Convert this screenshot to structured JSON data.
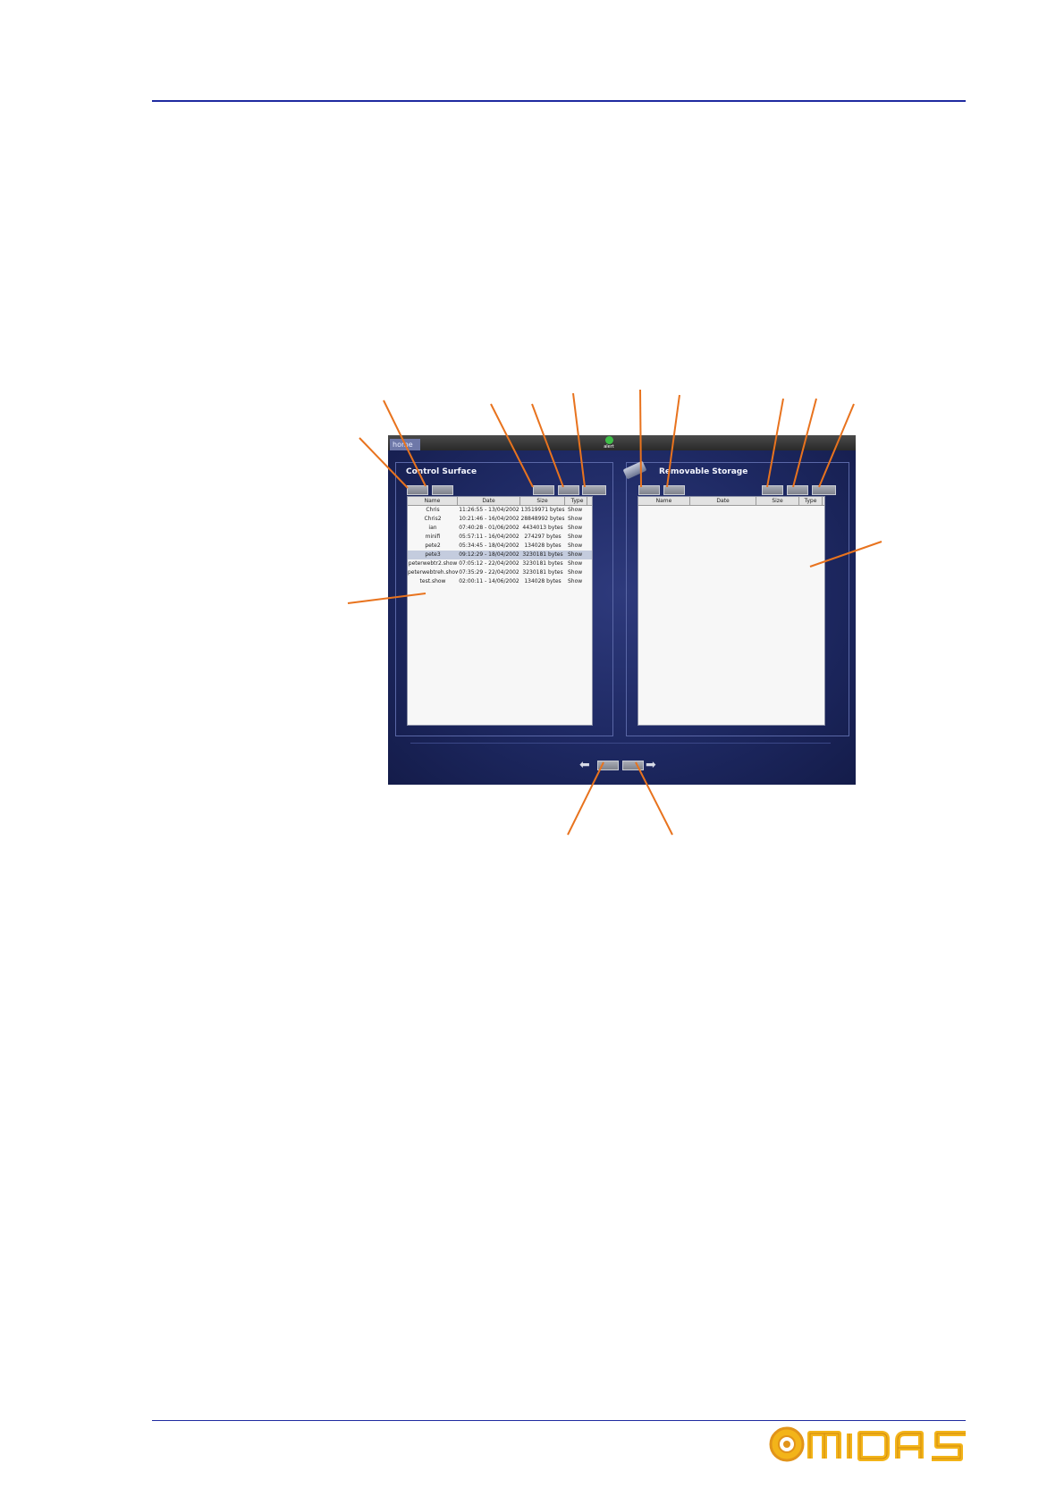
{
  "screen": {
    "home_tab": "home",
    "alert_label": "alert",
    "control_surface": {
      "title": "Control Surface",
      "columns": [
        "Name",
        "Date",
        "Size",
        "Type"
      ],
      "files": [
        {
          "name": "Chris",
          "date": "11:26:55 - 13/04/2002",
          "size": "13519971 bytes",
          "type": "Show"
        },
        {
          "name": "Chris2",
          "date": "10:21:46 - 16/04/2002",
          "size": "28848992 bytes",
          "type": "Show"
        },
        {
          "name": "ian",
          "date": "07:40:28 - 01/06/2002",
          "size": "4434013 bytes",
          "type": "Show"
        },
        {
          "name": "minifi",
          "date": "05:57:11 - 16/04/2002",
          "size": "274297 bytes",
          "type": "Show"
        },
        {
          "name": "pete2",
          "date": "05:34:45 - 18/04/2002",
          "size": "134028 bytes",
          "type": "Show"
        },
        {
          "name": "pete3",
          "date": "09:12:29 - 18/04/2002",
          "size": "3230181 bytes",
          "type": "Show"
        },
        {
          "name": "peterwebtr2.show",
          "date": "07:05:12 - 22/04/2002",
          "size": "3230181 bytes",
          "type": "Show"
        },
        {
          "name": "peterwebtreh.show",
          "date": "07:35:29 - 22/04/2002",
          "size": "3230181 bytes",
          "type": "Show"
        },
        {
          "name": "test.show",
          "date": "02:00:11 - 14/06/2002",
          "size": "134028 bytes",
          "type": "Show"
        }
      ]
    },
    "removable_storage": {
      "title": "Removable Storage",
      "columns": [
        "Name",
        "Date",
        "Size",
        "Type"
      ]
    }
  }
}
